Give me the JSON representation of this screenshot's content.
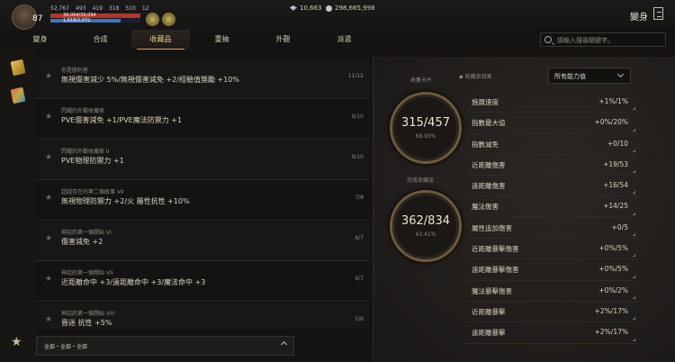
{
  "player": {
    "level": "87",
    "stats": [
      "52,767",
      "493",
      "419",
      "318",
      "510",
      "12"
    ],
    "hp_text": "39,094/39,094",
    "mp_text": "1,618/2,072"
  },
  "currency": {
    "small": "10,663",
    "large": "298,665,998"
  },
  "title": "變身",
  "tabs": [
    "變身",
    "合成",
    "收藏品",
    "重抽",
    "外觀",
    "派遣"
  ],
  "search": {
    "placeholder": "請輸入搜尋關鍵字。"
  },
  "collection_list": [
    {
      "title": "你是勝利者",
      "desc": "無視傷害減少 5%/無視傷害減免 +2/經驗值獎勵 +10%",
      "count": "11/12"
    },
    {
      "title": "閃耀的外觀收藏家",
      "desc": "PVE傷害減免 +1/PVE魔法防禦力 +1",
      "count": "9/10"
    },
    {
      "title": "閃耀的外觀收藏家 II",
      "desc": "PVE物理防禦力 +1",
      "count": "9/10"
    },
    {
      "title": "超越存在的第二個故事 VII",
      "desc": "無視物理防禦力 +2/火 屬性抗性 +10%",
      "count": "7/8"
    },
    {
      "title": "神話的第一個開始 VI",
      "desc": "傷害減免 +2",
      "count": "6/7"
    },
    {
      "title": "神話的第一個開始 VII",
      "desc": "近距離命中 +3/遠距離命中 +3/魔法命中 +3",
      "count": "6/7"
    },
    {
      "title": "神話的第一個開始 VIII",
      "desc": "昏迷 抗性 +5%",
      "count": "5/6"
    }
  ],
  "filter": {
    "label": "全部・全部・全部"
  },
  "summary": {
    "cards_label": "收集卡片",
    "cards_value": "315/457",
    "cards_pct": "68.93%",
    "done_label": "完成收藏品",
    "done_value": "362/834",
    "done_pct": "43.41%"
  },
  "stats_panel": {
    "header": "收藏品效果",
    "select_value": "所有能力值",
    "items": [
      {
        "label": "施展速度",
        "value": "+1%/1%"
      },
      {
        "label": "指數最大值",
        "value": "+0%/20%"
      },
      {
        "label": "指數減免",
        "value": "+0/10"
      },
      {
        "label": "近距離傷害",
        "value": "+19/53"
      },
      {
        "label": "遠距離傷害",
        "value": "+16/54"
      },
      {
        "label": "魔法傷害",
        "value": "+14/25"
      },
      {
        "label": "屬性追加傷害",
        "value": "+0/5"
      },
      {
        "label": "近距離暴擊傷害",
        "value": "+0%/5%"
      },
      {
        "label": "遠距離暴擊傷害",
        "value": "+0%/5%"
      },
      {
        "label": "魔法暴擊傷害",
        "value": "+0%/2%"
      },
      {
        "label": "近距離暴擊",
        "value": "+2%/17%"
      },
      {
        "label": "遠距離暴擊",
        "value": "+2%/17%"
      }
    ]
  },
  "colors": {
    "accent": "#c9a766",
    "hp": "#b2342a",
    "mp": "#3c75c4"
  },
  "bars": {
    "hp_fill": 1.0,
    "mp_fill": 0.78
  }
}
